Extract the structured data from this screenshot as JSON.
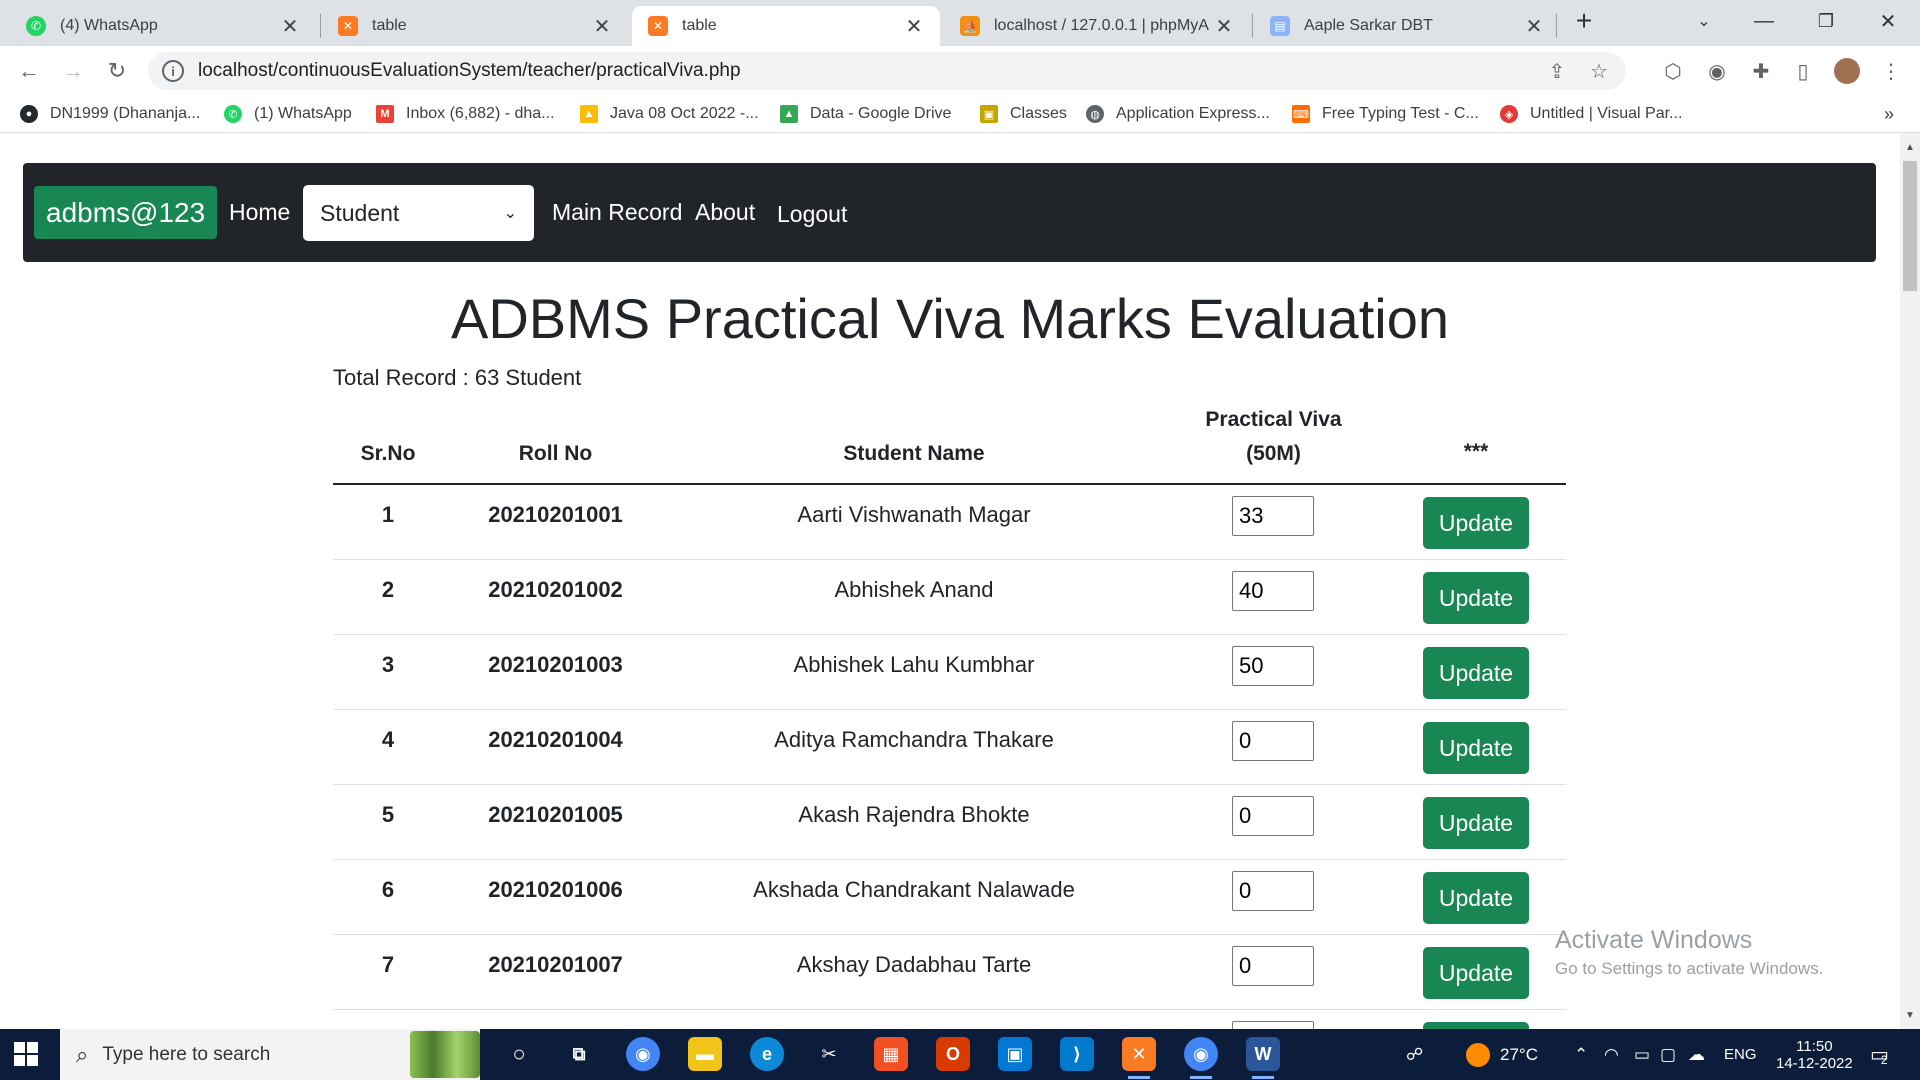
{
  "browser": {
    "tabs": [
      {
        "title": "(4) WhatsApp",
        "icon": "whatsapp-icon",
        "color": "#25d366",
        "glyph": "✆"
      },
      {
        "title": "table",
        "icon": "xampp-icon",
        "color": "#fb7a24",
        "glyph": "✕"
      },
      {
        "title": "table",
        "icon": "xampp-icon",
        "color": "#fb7a24",
        "glyph": "✕"
      },
      {
        "title": "localhost / 127.0.0.1 | phpMyA",
        "icon": "phpmyadmin-icon",
        "color": "#f29111",
        "glyph": "⛵"
      },
      {
        "title": "Aaple Sarkar DBT",
        "icon": "document-icon",
        "color": "#8ab4f8",
        "glyph": "▤"
      }
    ],
    "address": "localhost/continuousEvaluationSystem/teacher/practicalViva.php",
    "bookmarks": [
      {
        "label": "DN1999 (Dhananja...",
        "icon": "github-icon",
        "color": "#24292e"
      },
      {
        "label": "(1) WhatsApp",
        "icon": "whatsapp-icon",
        "color": "#25d366"
      },
      {
        "label": "Inbox (6,882) - dha...",
        "icon": "gmail-icon",
        "color": "#ea4335"
      },
      {
        "label": "Java 08 Oct 2022 -...",
        "icon": "google-drive-icon",
        "color": "#fbbc04"
      },
      {
        "label": "Data - Google Drive",
        "icon": "google-drive-icon",
        "color": "#34a853"
      },
      {
        "label": "Classes",
        "icon": "classroom-icon",
        "color": "#c7a500"
      },
      {
        "label": "Application Express...",
        "icon": "globe-icon",
        "color": "#5f6368"
      },
      {
        "label": "Free Typing Test - C...",
        "icon": "typing-icon",
        "color": "#ff6d00"
      },
      {
        "label": "Untitled | Visual Par...",
        "icon": "visual-paradigm-icon",
        "color": "#e53935"
      }
    ]
  },
  "nav": {
    "brand": "adbms@123",
    "home": "Home",
    "select": "Student",
    "main_record": "Main Record",
    "about": "About",
    "logout": "Logout"
  },
  "page": {
    "title": "ADBMS Practical Viva Marks Evaluation",
    "total": "Total Record : 63 Student"
  },
  "table": {
    "headers": {
      "srno": "Sr.No",
      "roll": "Roll No",
      "name": "Student Name",
      "viva_line1": "Practical Viva",
      "viva_line2": "(50M)",
      "action": "***"
    },
    "button_label": "Update",
    "rows": [
      {
        "sr": "1",
        "roll": "20210201001",
        "name": "Aarti Vishwanath Magar",
        "marks": "33"
      },
      {
        "sr": "2",
        "roll": "20210201002",
        "name": "Abhishek Anand",
        "marks": "40"
      },
      {
        "sr": "3",
        "roll": "20210201003",
        "name": "Abhishek Lahu Kumbhar",
        "marks": "50"
      },
      {
        "sr": "4",
        "roll": "20210201004",
        "name": "Aditya Ramchandra Thakare",
        "marks": "0"
      },
      {
        "sr": "5",
        "roll": "20210201005",
        "name": "Akash Rajendra Bhokte",
        "marks": "0"
      },
      {
        "sr": "6",
        "roll": "20210201006",
        "name": "Akshada Chandrakant Nalawade",
        "marks": "0"
      },
      {
        "sr": "7",
        "roll": "20210201007",
        "name": "Akshay Dadabhau Tarte",
        "marks": "0"
      }
    ]
  },
  "watermark": {
    "line1": "Activate Windows",
    "line2": "Go to Settings to activate Windows."
  },
  "taskbar": {
    "search_placeholder": "Type here to search",
    "weather": "27°C",
    "lang": "ENG",
    "time": "11:50",
    "date": "14-12-2022",
    "notifications": "2"
  },
  "colors": {
    "accent": "#198754",
    "navbar": "#212529",
    "taskbar": "#0b1d3a"
  }
}
